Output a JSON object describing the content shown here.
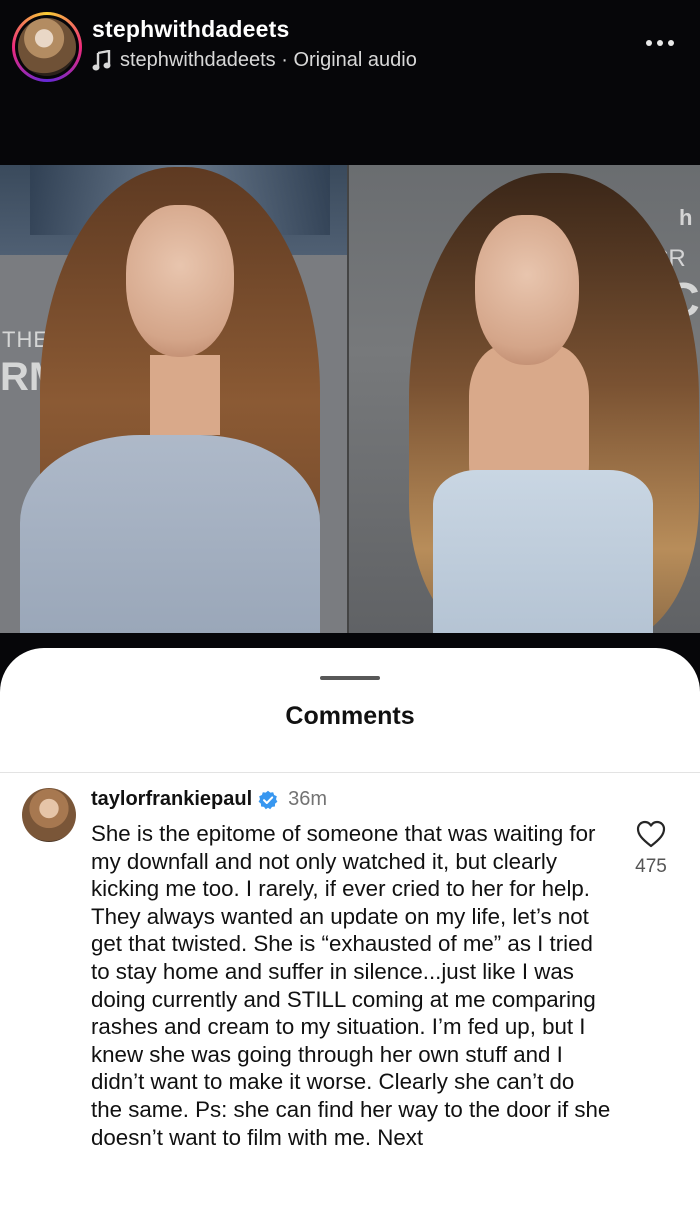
{
  "header": {
    "username": "stephwithdadeets",
    "audio_label": "stephwithdadeets · Original audio",
    "more_icon": "more-horizontal-icon",
    "note_icon": "music-note-icon"
  },
  "media": {
    "backdrop_left_text_1": "THE SEC",
    "backdrop_left_text_2": "RM",
    "backdrop_right_text_1": "SECR",
    "backdrop_right_text_2": "MC",
    "backdrop_logo_letter": "h"
  },
  "comments_sheet": {
    "title": "Comments",
    "comments": [
      {
        "username": "taylorfrankiepaul",
        "verified": true,
        "time": "36m",
        "text": "She is the epitome of someone that was waiting for my downfall and not only watched it, but clearly kicking me too. I rarely, if ever cried to her for help. They always wanted an update on my life, let’s not get that twisted. She is “exhausted of me” as I tried to stay home and suffer in silence...just like I was doing currently and STILL coming at me comparing rashes and cream to my situation. I’m fed up, but I knew she was going through her own stuff and I didn’t want to make it worse. Clearly she can’t do the same. Ps: she can find her way to the door if she doesn’t want to film with me. Next",
        "likes": "475"
      }
    ]
  },
  "colors": {
    "verified_blue": "#3897f0",
    "background_dark": "#060609",
    "sheet": "#ffffff"
  }
}
